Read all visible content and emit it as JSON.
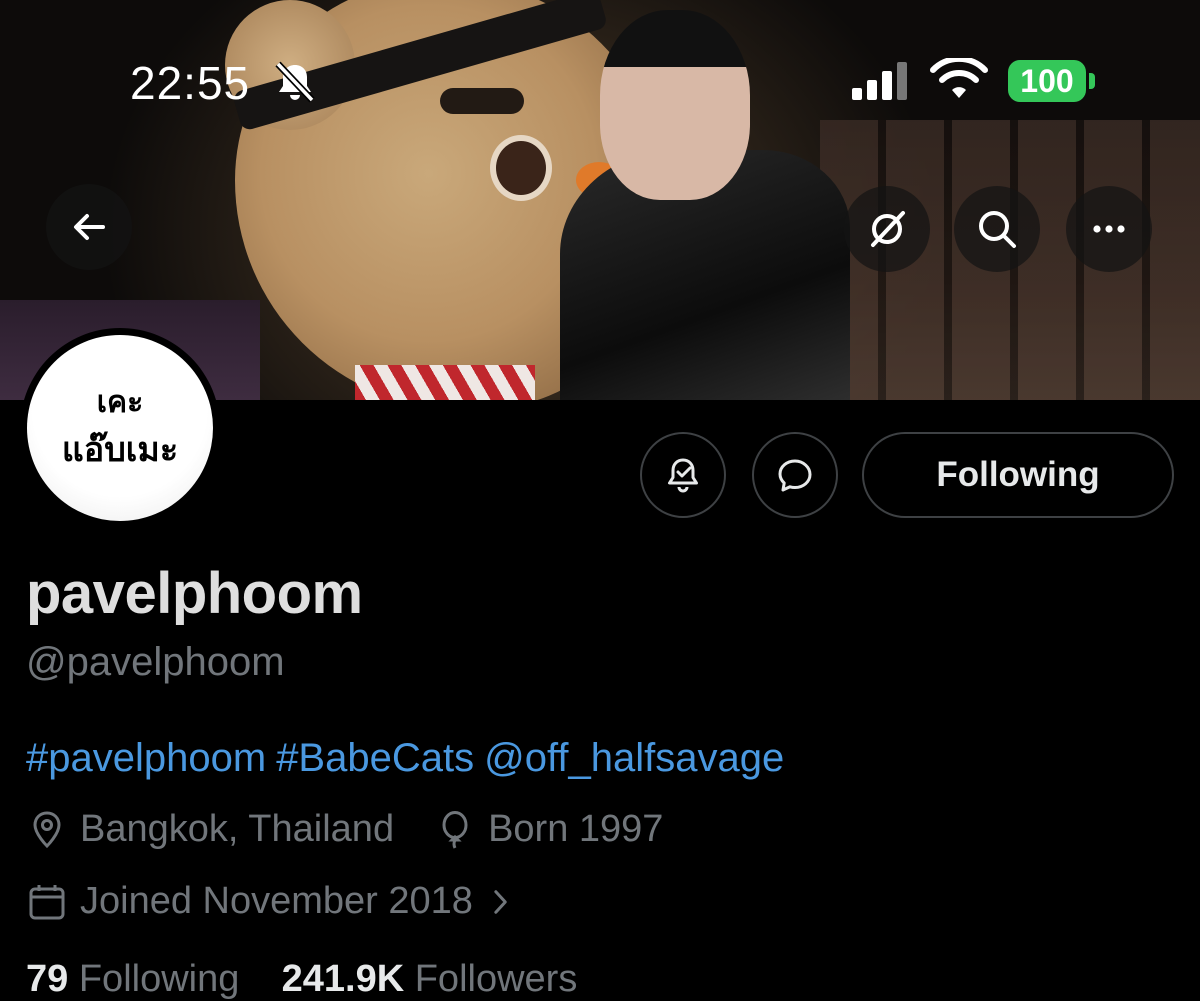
{
  "status_bar": {
    "time": "22:55",
    "battery": "100",
    "icons": [
      "bell-slash-icon",
      "signal-icon",
      "wifi-icon",
      "battery-icon"
    ]
  },
  "banner": {
    "buttons": [
      "back-arrow-icon",
      "grok-icon",
      "search-icon",
      "more-icon"
    ]
  },
  "avatar": {
    "line1": "เคะ",
    "line2": "แอ๊บเมะ"
  },
  "actions": {
    "notify_icon": "bell-check-icon",
    "message_icon": "message-bubble-icon",
    "following_label": "Following"
  },
  "profile": {
    "display_name": "pavelphoom",
    "handle": "@pavelphoom",
    "bio": {
      "tag1": "#pavelphoom",
      "tag2": "#BabeCats",
      "mention": "@off_halfsavage"
    },
    "location": "Bangkok, Thailand",
    "birth": "Born 1997",
    "joined": "Joined November 2018",
    "following_count": "79",
    "following_label": "Following",
    "followers_count": "241.9K",
    "followers_label": "Followers"
  },
  "colors": {
    "link": "#4a98e0",
    "muted": "#71767b",
    "battery": "#34c759"
  }
}
